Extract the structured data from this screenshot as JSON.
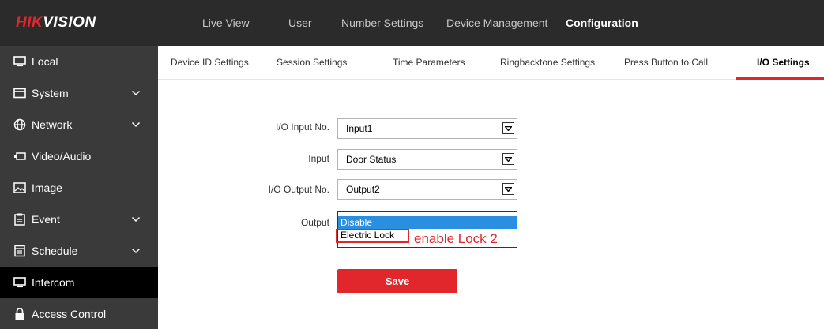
{
  "brand": {
    "logo_prefix": "HIK",
    "logo_suffix": "VISION"
  },
  "topnav": {
    "items": [
      {
        "label": "Live View"
      },
      {
        "label": "User"
      },
      {
        "label": "Number Settings"
      },
      {
        "label": "Device Management"
      },
      {
        "label": "Configuration",
        "active": true
      }
    ]
  },
  "sidebar": {
    "items": [
      {
        "label": "Local",
        "icon": "monitor-icon"
      },
      {
        "label": "System",
        "icon": "system-icon",
        "expandable": true
      },
      {
        "label": "Network",
        "icon": "globe-icon",
        "expandable": true
      },
      {
        "label": "Video/Audio",
        "icon": "camera-icon"
      },
      {
        "label": "Image",
        "icon": "image-icon"
      },
      {
        "label": "Event",
        "icon": "event-icon",
        "expandable": true
      },
      {
        "label": "Schedule",
        "icon": "calendar-icon",
        "expandable": true
      },
      {
        "label": "Intercom",
        "icon": "monitor-icon",
        "active": true
      },
      {
        "label": "Access Control",
        "icon": "lock-icon"
      }
    ]
  },
  "tabs": [
    {
      "label": "Device ID Settings"
    },
    {
      "label": "Session Settings"
    },
    {
      "label": "Time Parameters"
    },
    {
      "label": "Ringbacktone Settings"
    },
    {
      "label": "Press Button to Call"
    },
    {
      "label": "I/O Settings",
      "active": true
    }
  ],
  "form": {
    "io_input_no": {
      "label": "I/O Input No.",
      "value": "Input1"
    },
    "input": {
      "label": "Input",
      "value": "Door Status"
    },
    "io_output_no": {
      "label": "I/O Output No.",
      "value": "Output2"
    },
    "output": {
      "label": "Output",
      "options": [
        "Disable",
        "Electric Lock"
      ],
      "highlighted": "Disable"
    },
    "save_label": "Save"
  },
  "annotation": {
    "text": "enable Lock 2"
  },
  "colors": {
    "accent": "#e1262c",
    "topbar": "#2b2b2b",
    "sidebar": "#3a3a3a",
    "sidebar_active": "#000000",
    "option_highlight": "#2a8fe0"
  }
}
